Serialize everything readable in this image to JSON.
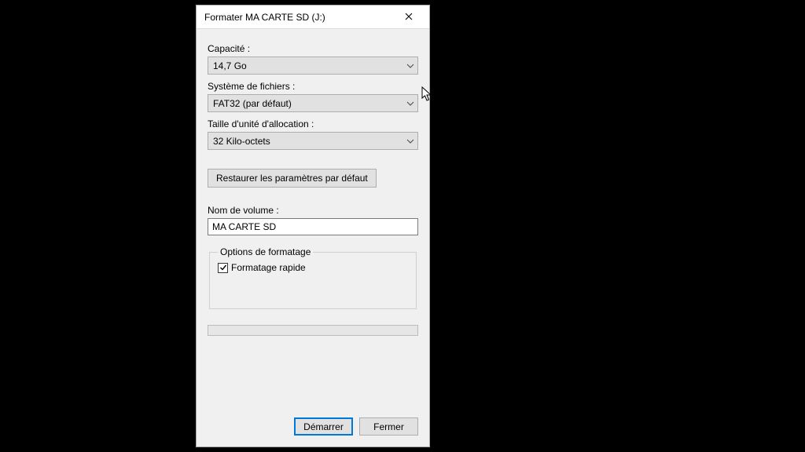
{
  "dialog": {
    "title": "Formater MA CARTE SD (J:)",
    "labels": {
      "capacity": "Capacité :",
      "filesystem": "Système de fichiers :",
      "allocation": "Taille d'unité d'allocation :",
      "volume": "Nom de volume :",
      "options_group": "Options de formatage",
      "quick_format": "Formatage rapide"
    },
    "values": {
      "capacity": "14,7 Go",
      "filesystem": "FAT32 (par défaut)",
      "allocation": "32 Kilo-octets",
      "volume": "MA CARTE SD"
    },
    "buttons": {
      "restore": "Restaurer les paramètres par défaut",
      "start": "Démarrer",
      "close": "Fermer"
    }
  }
}
